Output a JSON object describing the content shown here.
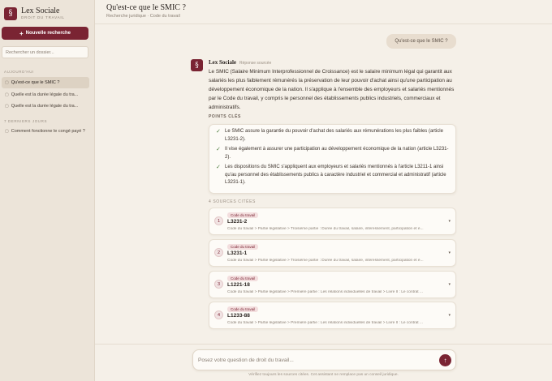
{
  "brand": {
    "logo": "§",
    "title": "Lex Sociale",
    "subtitle": "DROIT DU TRAVAIL"
  },
  "sidebar": {
    "new_search_label": "Nouvelle recherche",
    "search_placeholder": "Rechercher un dossier...",
    "today_label": "AUJOURD'HUI",
    "today_items": [
      {
        "label": "Qu'est-ce que le SMIC ?",
        "active": true
      },
      {
        "label": "Quelle est la durée légale du tra..."
      },
      {
        "label": "Quelle est la durée légale du tra..."
      }
    ],
    "week_label": "7 DERNIERS JOURS",
    "week_items": [
      {
        "label": "Comment fonctionne le congé payé ?"
      }
    ]
  },
  "header": {
    "title": "Qu'est-ce que le SMIC ?",
    "breadcrumb": "Recherche juridique · Code du travail"
  },
  "conversation": {
    "user_message": "Qu'est-ce que le SMIC ?",
    "assistant": {
      "avatar": "§",
      "name": "Lex Sociale",
      "tag": "Réponse sourcée",
      "answer": "Le SMIC (Salaire Minimum Interprofessionnel de Croissance) est le salaire minimum légal qui garantit aux salariés les plus faiblement rémunérés la préservation de leur pouvoir d'achat ainsi qu'une participation au développement économique de la nation. Il s'applique à l'ensemble des employeurs et salariés mentionnés par le Code du travail, y compris le personnel des établissements publics industriels, commerciaux et administratifs.",
      "points_label": "POINTS CLÉS",
      "points": [
        "Le SMIC assure la garantie du pouvoir d'achat des salariés aux rémunérations les plus faibles (article L3231-2).",
        "Il vise également à assurer une participation au développement économique de la nation (article L3231-2).",
        "Les dispositions du SMIC s'appliquent aux employeurs et salariés mentionnés à l'article L3211-1 ainsi qu'au personnel des établissements publics à caractère industriel et commercial et administratif (article L3231-1)."
      ],
      "sources_label": "4 SOURCES CITÉES",
      "sources": [
        {
          "num": "1",
          "badge": "Code du travail",
          "code": "L3231-2",
          "path": "Code du travail > Partie législative > Troisième partie : Durée du travail, salaire, intéressement, participation et é..."
        },
        {
          "num": "2",
          "badge": "Code du travail",
          "code": "L3231-1",
          "path": "Code du travail > Partie législative > Troisième partie : Durée du travail, salaire, intéressement, participation et é..."
        },
        {
          "num": "3",
          "badge": "Code du travail",
          "code": "L1221-18",
          "path": "Code du travail > Partie législative > Première partie : Les relations individuelles de travail > Livre II : Le contrat ..."
        },
        {
          "num": "4",
          "badge": "Code du travail",
          "code": "L1233-88",
          "path": "Code du travail > Partie législative > Première partie : Les relations individuelles de travail > Livre II : Le contrat ..."
        }
      ]
    }
  },
  "composer": {
    "placeholder": "Posez votre question de droit du travail...",
    "send_icon": "↑",
    "disclaimer": "Vérifiez toujours les sources citées. Cet assistant ne remplace pas un conseil juridique."
  },
  "colors": {
    "accent": "#7a2433",
    "sidebar_bg": "#ece4d9",
    "page_bg": "#f5f0e8"
  }
}
